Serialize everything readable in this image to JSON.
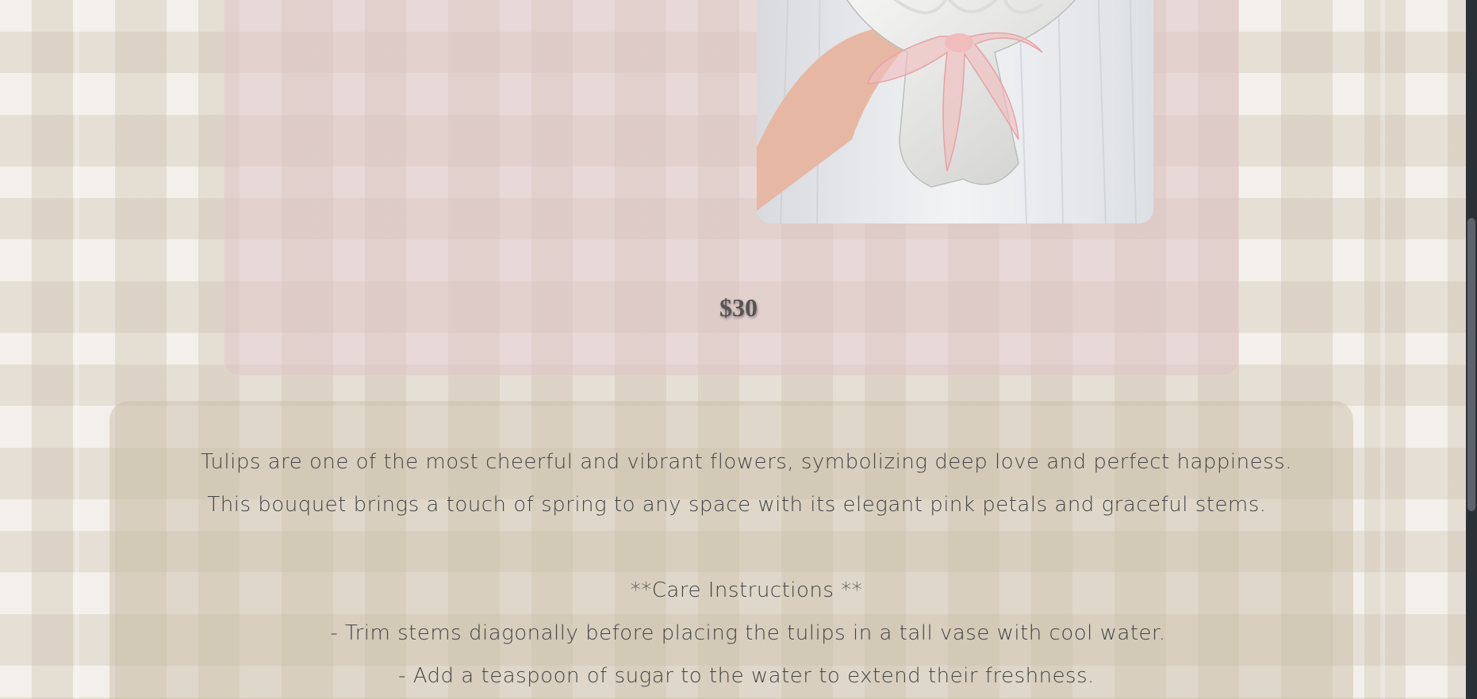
{
  "product": {
    "price": "$30",
    "image_alt": "Tulip bouquet wrapped in white paper with pink ribbon"
  },
  "description": {
    "lines": [
      "Tulips are one of the most cheerful and vibrant flowers, symbolizing deep love and perfect happiness.",
      "This bouquet brings a touch of spring to any space with its elegant pink petals and graceful stems.",
      "**Care Instructions **",
      "- Trim stems diagonally before placing the tulips in a tall vase with cool water.",
      "- Add a teaspoon of sugar to the water to extend their freshness."
    ]
  },
  "colors": {
    "product_card": "#e0c4c8",
    "description_card": "#c8bca5",
    "price_text": "#555555",
    "body_text": "#444444"
  }
}
